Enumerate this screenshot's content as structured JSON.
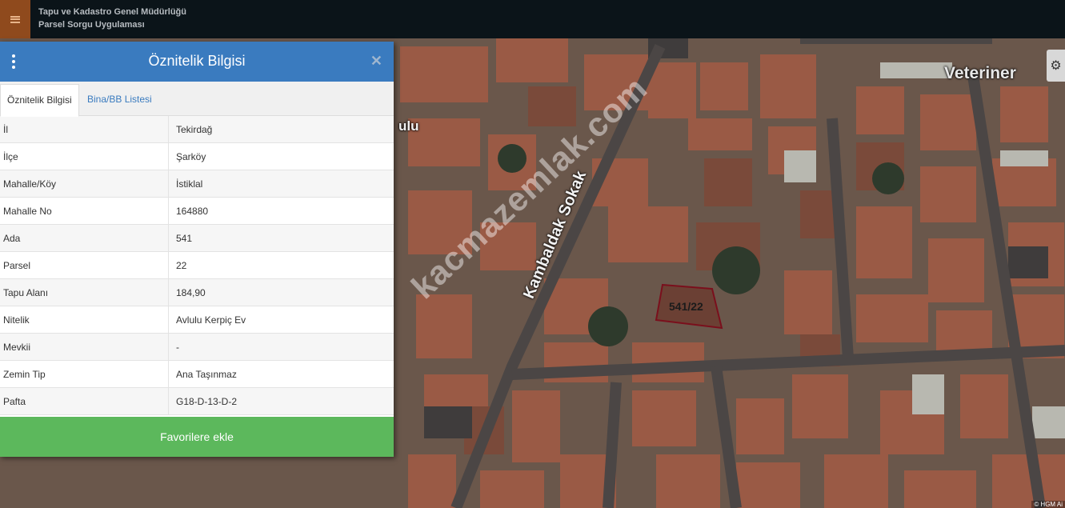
{
  "header": {
    "org_name": "Tapu ve Kadastro Genel Müdürlüğü",
    "app_name": "Parsel Sorgu Uygulaması"
  },
  "map": {
    "street_label": "Kambaldak Sokak",
    "veteriner_label": "Veteriner",
    "partial_label": "ulu",
    "parcel_label": "541/22",
    "watermark": "kacmazemlak.com",
    "attribution": "© HGM Ai"
  },
  "panel": {
    "title": "Öznitelik Bilgisi",
    "tabs": [
      "Öznitelik Bilgisi",
      "Bina/BB Listesi"
    ],
    "rows": [
      {
        "key": "İl",
        "value": "Tekirdağ"
      },
      {
        "key": "İlçe",
        "value": "Şarköy"
      },
      {
        "key": "Mahalle/Köy",
        "value": "İstiklal"
      },
      {
        "key": "Mahalle No",
        "value": "164880"
      },
      {
        "key": "Ada",
        "value": "541"
      },
      {
        "key": "Parsel",
        "value": "22"
      },
      {
        "key": "Tapu Alanı",
        "value": "184,90"
      },
      {
        "key": "Nitelik",
        "value": "Avlulu Kerpiç Ev"
      },
      {
        "key": "Mevkii",
        "value": "-"
      },
      {
        "key": "Zemin Tip",
        "value": "Ana Taşınmaz"
      },
      {
        "key": "Pafta",
        "value": "G18-D-13-D-2"
      }
    ],
    "favorite_button": "Favorilere ekle"
  },
  "icons": {
    "menu": "hamburger-icon",
    "kebab": "kebab-menu-icon",
    "close": "close-icon",
    "settings": "gear-icon"
  },
  "colors": {
    "topbar": "#0b1419",
    "menu_button": "#8f4a1d",
    "panel_header": "#3a7bbf",
    "favorite_button": "#5cb85c",
    "parcel_outline": "#7a0f1c"
  }
}
